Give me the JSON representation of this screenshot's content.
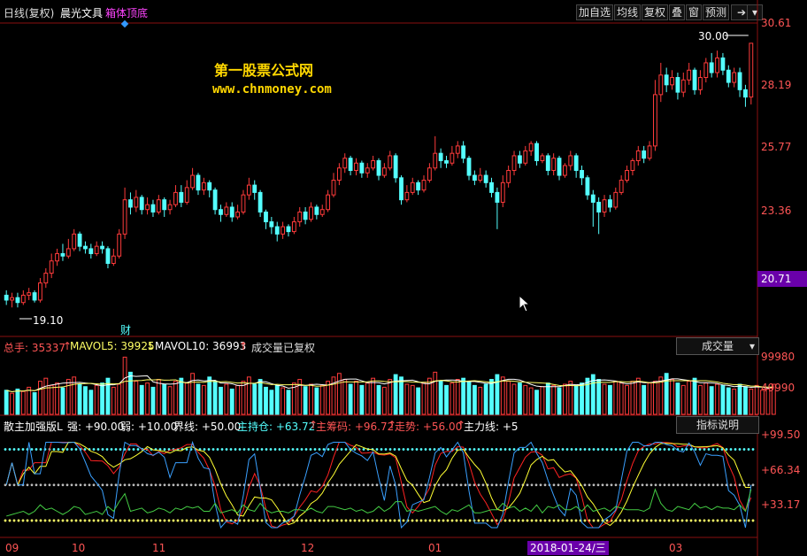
{
  "window": {
    "period": "日线(复权)",
    "stock_name": "晨光文具",
    "indicator_name": "箱体顶底",
    "buttons": [
      "加自选",
      "均线",
      "复权",
      "叠",
      "窗",
      "预测"
    ]
  },
  "watermark": {
    "line1": "第一股票公式网",
    "line2": "www.chnmoney.com"
  },
  "price_axis": {
    "ticks": [
      "30.61",
      "28.19",
      "25.77",
      "23.36",
      "20.71"
    ],
    "current_price_badge": "20.71",
    "high_marker": "30.00",
    "low_marker": "19.10",
    "finance_marker": "财"
  },
  "volume_pane": {
    "total_hands_label": "总手: 35337",
    "total_hands_arrow": "↑",
    "mavol5_label": "MAVOL5: 39925",
    "mavol5_arrow": "↓",
    "mavol10_label": "MAVOL10: 36993",
    "mavol10_arrow": "↑",
    "status": "成交量已复权",
    "selector": "成交量",
    "ticks": [
      "99980",
      "49990"
    ]
  },
  "indicator_pane": {
    "name": "散主加强版L",
    "strong": "强: +90.00",
    "weak": "弱: +10.00",
    "boundary": "界线: +50.00",
    "main_holding": "主持仓: +63.72",
    "main_holding_arrow": "↑",
    "main_chips": "主筹码: +96.72",
    "main_chips_arrow": "↑",
    "trend": "走势: +56.00",
    "trend_arrow": "↑",
    "main_line": "主力线: +5",
    "help_button": "指标说明",
    "ticks": [
      "+99.50",
      "+66.34",
      "+33.17"
    ]
  },
  "date_axis": {
    "labels": [
      "09",
      "10",
      "11",
      "12",
      "01",
      "03"
    ],
    "cursor_date": "2018-01-24/三"
  },
  "colors": {
    "background": "#000000",
    "up": "#ff3b3b",
    "down": "#54ffff",
    "axis": "#ff5555",
    "grid": "#8a1010",
    "watermark": "#ffd700",
    "badge": "#6a00aa"
  },
  "chart_data": {
    "type": "candlestick",
    "price_range": [
      19.1,
      30.61
    ],
    "candles": [
      [
        19.7,
        19.5,
        19.9,
        19.3
      ],
      [
        19.5,
        19.6,
        19.8,
        19.2
      ],
      [
        19.6,
        19.4,
        19.8,
        19.2
      ],
      [
        19.4,
        19.7,
        19.9,
        19.3
      ],
      [
        19.7,
        19.8,
        20.0,
        19.5
      ],
      [
        19.8,
        19.5,
        19.9,
        19.4
      ],
      [
        19.5,
        20.2,
        20.4,
        19.4
      ],
      [
        20.2,
        20.6,
        20.8,
        20.0
      ],
      [
        20.6,
        21.1,
        21.4,
        20.4
      ],
      [
        21.1,
        21.4,
        21.6,
        20.9
      ],
      [
        21.4,
        21.3,
        21.8,
        21.1
      ],
      [
        21.3,
        21.6,
        22.0,
        21.2
      ],
      [
        21.6,
        22.2,
        22.4,
        21.5
      ],
      [
        22.2,
        21.7,
        22.3,
        21.5
      ],
      [
        21.7,
        21.6,
        21.9,
        21.4
      ],
      [
        21.6,
        21.4,
        21.8,
        21.2
      ],
      [
        21.4,
        21.7,
        21.9,
        21.3
      ],
      [
        21.7,
        21.6,
        21.9,
        21.4
      ],
      [
        21.6,
        21.0,
        21.7,
        20.8
      ],
      [
        21.0,
        21.3,
        21.6,
        20.9
      ],
      [
        21.3,
        22.2,
        22.4,
        21.2
      ],
      [
        22.2,
        23.6,
        24.1,
        22.0
      ],
      [
        23.6,
        23.3,
        23.9,
        23.0
      ],
      [
        23.3,
        23.7,
        24.0,
        23.1
      ],
      [
        23.7,
        23.2,
        23.8,
        23.0
      ],
      [
        23.2,
        23.4,
        23.7,
        23.0
      ],
      [
        23.4,
        23.1,
        23.6,
        22.9
      ],
      [
        23.1,
        23.6,
        23.8,
        23.0
      ],
      [
        23.6,
        23.2,
        23.7,
        22.9
      ],
      [
        23.2,
        23.4,
        23.6,
        23.0
      ],
      [
        23.4,
        23.9,
        24.2,
        23.3
      ],
      [
        23.9,
        23.5,
        24.2,
        23.3
      ],
      [
        23.5,
        24.1,
        24.4,
        23.4
      ],
      [
        24.1,
        24.6,
        24.9,
        24.0
      ],
      [
        24.6,
        24.0,
        24.7,
        23.8
      ],
      [
        24.0,
        24.3,
        24.5,
        23.8
      ],
      [
        24.3,
        24.0,
        24.4,
        23.7
      ],
      [
        24.0,
        23.2,
        24.1,
        23.0
      ],
      [
        23.2,
        23.0,
        23.4,
        22.7
      ],
      [
        23.0,
        23.3,
        23.5,
        22.9
      ],
      [
        23.3,
        22.9,
        23.5,
        22.7
      ],
      [
        22.9,
        23.1,
        23.4,
        22.8
      ],
      [
        23.1,
        23.8,
        24.0,
        23.0
      ],
      [
        23.8,
        24.2,
        24.5,
        23.6
      ],
      [
        24.2,
        23.9,
        24.4,
        23.6
      ],
      [
        23.9,
        23.1,
        24.0,
        22.9
      ],
      [
        23.1,
        22.7,
        23.2,
        22.4
      ],
      [
        22.7,
        22.5,
        22.9,
        22.2
      ],
      [
        22.5,
        22.2,
        22.7,
        21.9
      ],
      [
        22.2,
        22.5,
        22.7,
        22.0
      ],
      [
        22.5,
        22.3,
        22.6,
        22.1
      ],
      [
        22.3,
        22.7,
        22.9,
        22.2
      ],
      [
        22.7,
        23.1,
        23.3,
        22.5
      ],
      [
        23.1,
        22.8,
        23.3,
        22.6
      ],
      [
        22.8,
        23.3,
        23.5,
        22.7
      ],
      [
        23.3,
        23.0,
        23.4,
        22.8
      ],
      [
        23.0,
        23.2,
        23.4,
        22.9
      ],
      [
        23.2,
        23.8,
        24.0,
        23.1
      ],
      [
        23.8,
        24.4,
        24.7,
        23.7
      ],
      [
        24.4,
        24.9,
        25.1,
        24.2
      ],
      [
        24.9,
        25.3,
        25.5,
        24.7
      ],
      [
        25.3,
        24.8,
        25.4,
        24.6
      ],
      [
        24.8,
        25.1,
        25.3,
        24.6
      ],
      [
        25.1,
        24.7,
        25.2,
        24.5
      ],
      [
        24.7,
        24.9,
        25.1,
        24.5
      ],
      [
        24.9,
        25.2,
        25.4,
        24.8
      ],
      [
        25.2,
        24.6,
        25.3,
        24.4
      ],
      [
        24.6,
        24.9,
        25.1,
        24.5
      ],
      [
        24.9,
        25.4,
        25.6,
        24.8
      ],
      [
        25.4,
        24.5,
        25.5,
        24.3
      ],
      [
        24.5,
        23.6,
        24.6,
        23.4
      ],
      [
        23.6,
        23.9,
        24.2,
        23.5
      ],
      [
        23.9,
        24.3,
        24.5,
        23.8
      ],
      [
        24.3,
        24.0,
        24.4,
        23.8
      ],
      [
        24.0,
        24.4,
        24.6,
        23.9
      ],
      [
        24.4,
        24.9,
        25.1,
        24.3
      ],
      [
        24.9,
        25.5,
        26.2,
        24.8
      ],
      [
        25.5,
        25.2,
        25.7,
        24.9
      ],
      [
        25.2,
        25.1,
        25.4,
        24.9
      ],
      [
        25.1,
        25.5,
        25.8,
        25.0
      ],
      [
        25.5,
        25.8,
        26.0,
        25.3
      ],
      [
        25.8,
        25.3,
        26.0,
        25.1
      ],
      [
        25.3,
        24.6,
        25.4,
        24.4
      ],
      [
        24.6,
        24.4,
        24.8,
        24.2
      ],
      [
        24.4,
        24.6,
        24.9,
        24.3
      ],
      [
        24.6,
        24.3,
        24.8,
        24.1
      ],
      [
        24.3,
        23.9,
        24.5,
        23.7
      ],
      [
        23.9,
        23.5,
        24.1,
        22.4
      ],
      [
        23.5,
        24.3,
        24.6,
        23.3
      ],
      [
        24.3,
        24.8,
        25.0,
        24.1
      ],
      [
        24.8,
        25.4,
        25.6,
        24.6
      ],
      [
        25.4,
        25.1,
        25.6,
        24.9
      ],
      [
        25.1,
        25.6,
        25.8,
        25.0
      ],
      [
        25.6,
        25.9,
        26.0,
        25.4
      ],
      [
        25.9,
        25.2,
        26.0,
        25.0
      ],
      [
        25.2,
        25.4,
        25.5,
        25.1
      ],
      [
        25.4,
        24.8,
        25.5,
        24.6
      ],
      [
        24.8,
        25.3,
        25.5,
        24.6
      ],
      [
        25.3,
        24.6,
        25.4,
        24.4
      ],
      [
        24.6,
        25.0,
        25.1,
        24.5
      ],
      [
        25.0,
        25.4,
        25.6,
        24.8
      ],
      [
        25.4,
        24.8,
        25.5,
        24.5
      ],
      [
        24.8,
        24.5,
        25.0,
        24.2
      ],
      [
        24.5,
        23.8,
        24.6,
        23.6
      ],
      [
        23.8,
        23.5,
        24.0,
        22.5
      ],
      [
        23.5,
        23.1,
        23.7,
        22.2
      ],
      [
        23.1,
        23.6,
        23.8,
        22.9
      ],
      [
        23.6,
        23.3,
        23.8,
        23.1
      ],
      [
        23.3,
        23.9,
        24.1,
        23.2
      ],
      [
        23.9,
        24.4,
        24.6,
        23.8
      ],
      [
        24.4,
        24.8,
        25.0,
        24.3
      ],
      [
        24.8,
        25.2,
        25.3,
        24.6
      ],
      [
        25.2,
        25.6,
        25.8,
        25.0
      ],
      [
        25.6,
        25.3,
        25.8,
        25.1
      ],
      [
        25.3,
        25.8,
        26.0,
        25.2
      ],
      [
        25.8,
        27.9,
        28.5,
        25.6
      ],
      [
        27.9,
        28.7,
        29.2,
        27.6
      ],
      [
        28.7,
        28.3,
        29.0,
        28.0
      ],
      [
        28.3,
        28.6,
        28.9,
        28.1
      ],
      [
        28.6,
        28.0,
        28.8,
        27.7
      ],
      [
        28.0,
        28.5,
        28.8,
        27.8
      ],
      [
        28.5,
        28.9,
        29.2,
        28.3
      ],
      [
        28.9,
        28.1,
        29.0,
        27.9
      ],
      [
        28.1,
        28.6,
        28.9,
        27.9
      ],
      [
        28.6,
        29.2,
        29.4,
        28.4
      ],
      [
        29.2,
        28.8,
        29.6,
        28.6
      ],
      [
        28.8,
        29.4,
        29.7,
        28.6
      ],
      [
        29.4,
        28.9,
        29.6,
        28.7
      ],
      [
        28.9,
        28.4,
        29.1,
        28.2
      ],
      [
        28.4,
        28.8,
        29.0,
        28.2
      ],
      [
        28.8,
        28.1,
        29.0,
        27.8
      ],
      [
        28.1,
        27.8,
        28.3,
        27.4
      ],
      [
        27.8,
        30.0,
        30.0,
        27.5
      ]
    ],
    "volume": [
      40,
      35,
      42,
      38,
      45,
      36,
      55,
      60,
      48,
      52,
      44,
      58,
      62,
      50,
      46,
      40,
      48,
      52,
      60,
      45,
      50,
      95,
      70,
      55,
      48,
      52,
      45,
      58,
      50,
      46,
      55,
      60,
      52,
      68,
      50,
      48,
      62,
      55,
      45,
      50,
      42,
      48,
      55,
      62,
      50,
      58,
      45,
      40,
      48,
      44,
      40,
      52,
      58,
      46,
      50,
      44,
      48,
      55,
      62,
      68,
      58,
      50,
      55,
      48,
      52,
      60,
      48,
      45,
      58,
      66,
      62,
      50,
      48,
      44,
      52,
      60,
      70,
      55,
      48,
      52,
      58,
      60,
      55,
      48,
      45,
      50,
      58,
      66,
      62,
      55,
      50,
      52,
      48,
      44,
      40,
      46,
      52,
      48,
      44,
      50,
      55,
      48,
      52,
      60,
      66,
      58,
      50,
      48,
      55,
      52,
      48,
      55,
      60,
      48,
      52,
      55,
      62,
      68,
      58,
      52,
      48,
      55,
      60,
      48,
      52,
      46,
      50,
      48,
      44,
      42,
      50,
      46,
      42,
      48,
      40,
      42,
      50
    ],
    "volume_range": [
      0,
      99980
    ],
    "indicator_range": [
      0,
      99.5
    ],
    "indicator_series": {
      "strong_level": 90,
      "weak_level": 10,
      "boundary": 50
    }
  }
}
